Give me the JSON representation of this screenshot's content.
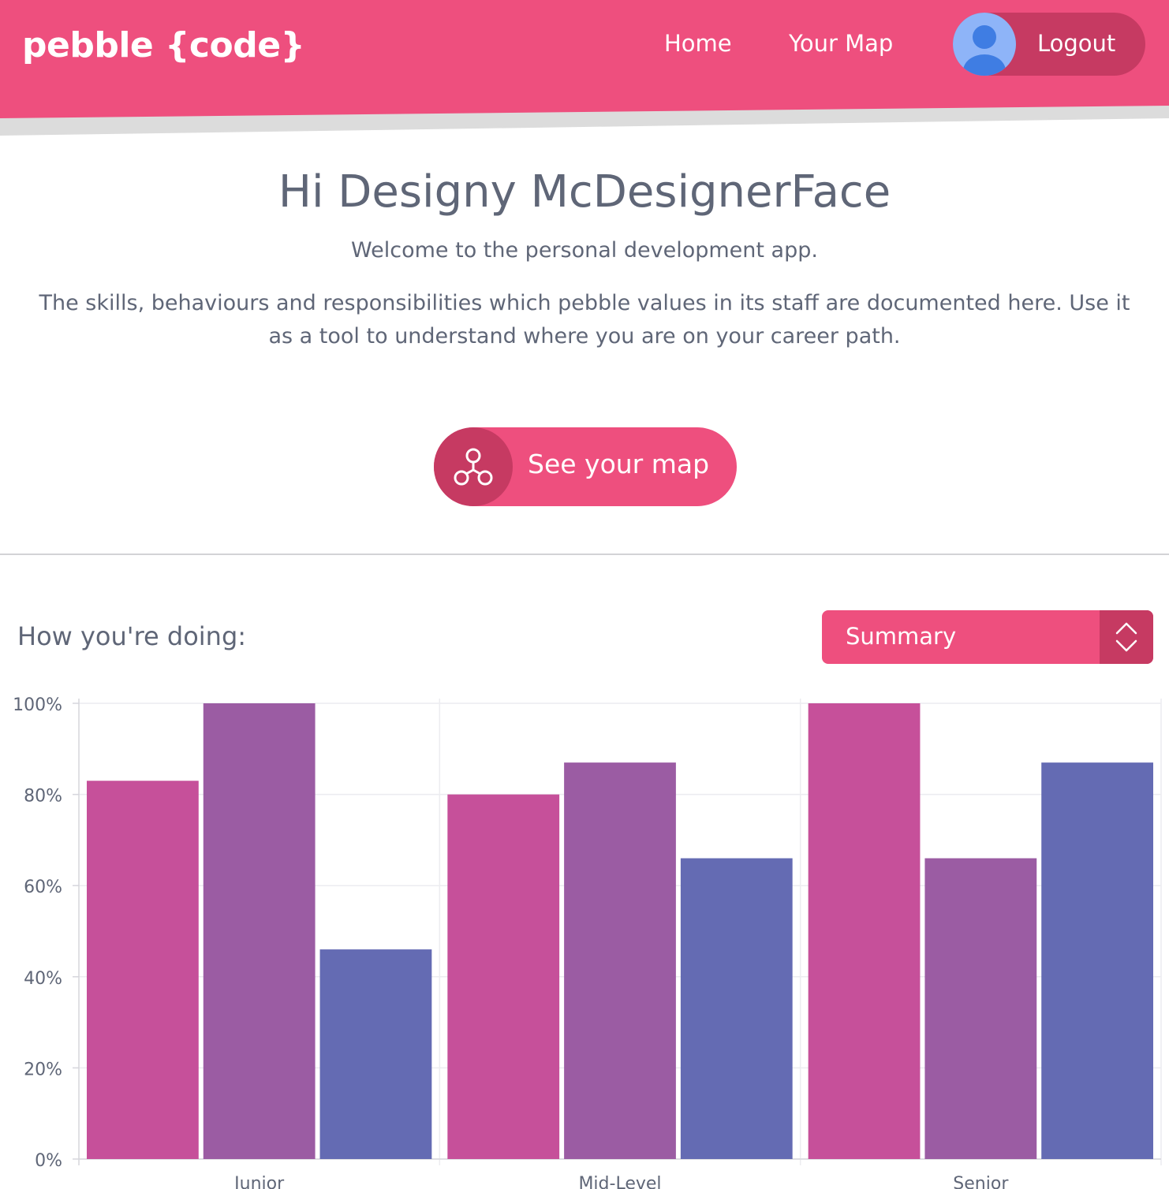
{
  "header": {
    "logo": "pebble {code}",
    "nav": {
      "home_label": "Home",
      "map_label": "Your Map"
    },
    "logout_label": "Logout",
    "avatar_icon": "user-avatar-icon"
  },
  "colors": {
    "brand": "#ee4f7e",
    "brand_dark": "#c63a62",
    "text": "#5f6677",
    "avatar_bg": "#8eb4f8",
    "avatar_fg": "#3f7de3"
  },
  "welcome": {
    "greeting": "Hi Designy McDesignerFace",
    "intro": "Welcome to the personal development app.",
    "description": "The skills, behaviours and responsibilities which pebble values in its staff are documented here. Use it as a tool to understand where you are on your career path.",
    "cta_label": "See your map",
    "cta_icon": "network-nodes-icon"
  },
  "doing": {
    "title": "How you're doing:",
    "select_value": "Summary",
    "select_icon": "chevron-up-down-icon"
  },
  "chart_data": {
    "type": "bar",
    "categories": [
      "Junior",
      "Mid-Level",
      "Senior"
    ],
    "series": [
      {
        "values": [
          83,
          80,
          100
        ],
        "color": "#c6509a"
      },
      {
        "values": [
          100,
          87,
          66
        ],
        "color": "#9b5ca3"
      },
      {
        "values": [
          46,
          66,
          87
        ],
        "color": "#646bb3"
      }
    ],
    "yticks": [
      "0%",
      "20%",
      "40%",
      "60%",
      "80%",
      "100%"
    ],
    "ylim": [
      0,
      100
    ],
    "grid": true
  }
}
